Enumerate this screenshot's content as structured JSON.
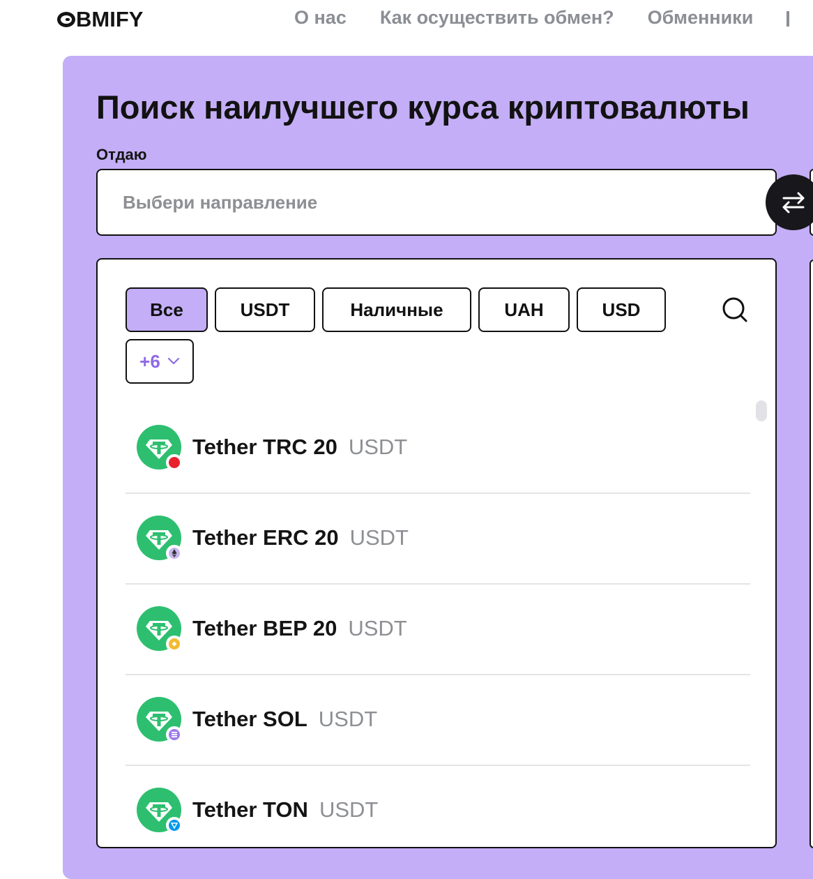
{
  "header": {
    "logo_text": "BMIFY",
    "nav": [
      {
        "label": "О нас"
      },
      {
        "label": "Как осуществить обмен?"
      },
      {
        "label": "Обменники"
      }
    ]
  },
  "main": {
    "title": "Поиск наилучшего курса криптовалюты",
    "give_label": "Отдаю",
    "give_placeholder": "Выбери направление"
  },
  "filters": {
    "chips": [
      {
        "label": "Все",
        "active": true
      },
      {
        "label": "USDT",
        "active": false
      },
      {
        "label": "Наличные",
        "active": false
      },
      {
        "label": "UAH",
        "active": false
      },
      {
        "label": "USD",
        "active": false
      }
    ],
    "more_label": "+6"
  },
  "currencies": [
    {
      "name": "Tether TRC 20",
      "code": "USDT",
      "network_icon": "tron-icon",
      "network_color": "#e8222d"
    },
    {
      "name": "Tether ERC 20",
      "code": "USDT",
      "network_icon": "ethereum-icon",
      "network_color": "#c8b7f0"
    },
    {
      "name": "Tether BEP 20",
      "code": "USDT",
      "network_icon": "bnb-icon",
      "network_color": "#f3ba2f"
    },
    {
      "name": "Tether SOL",
      "code": "USDT",
      "network_icon": "solana-icon",
      "network_color": "#9b7bea"
    },
    {
      "name": "Tether TON",
      "code": "USDT",
      "network_icon": "ton-icon",
      "network_color": "#0098ea"
    }
  ],
  "colors": {
    "accent": "#c4aef7",
    "tether_green": "#2dbf6f",
    "muted_text": "#8d8f93",
    "more_chip_text": "#8f6ae6"
  }
}
